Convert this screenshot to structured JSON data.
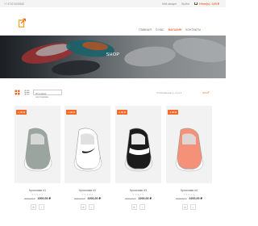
{
  "topbar": {
    "left_text": "+7 4742 4446160",
    "links": [
      "Мой аккаунт",
      "Выйти",
      "0 item(s) - 0,00 ₽"
    ]
  },
  "header": {
    "nav": [
      "Главная",
      "О нас",
      "Магазин",
      "Контакты"
    ],
    "active_nav": "Магазин"
  },
  "hero": {
    "title": "SHOP"
  },
  "toolbar": {
    "sort_label": "Исходная сортировка",
    "result_count": "Отображение 1–4 из 4",
    "show_label": "Show"
  },
  "products": [
    {
      "badge": "-1,00 ₽",
      "name": "Кроссовки #1",
      "rating": "★★★★★",
      "old_price": "3000,00 ₽",
      "price": "1500,00 ₽",
      "shoe_color": "#9aa5a0"
    },
    {
      "badge": "-1,00 ₽",
      "name": "Кроссовки #2",
      "rating": "★★★★★",
      "old_price": "3000,00 ₽",
      "price": "2200,00 ₽",
      "shoe_color": "#ffffff"
    },
    {
      "badge": "-1,00 ₽",
      "name": "Кроссовки #3",
      "rating": "★★★★★",
      "old_price": "3000,00 ₽",
      "price": "2200,00 ₽",
      "shoe_color": "#1b1b1b"
    },
    {
      "badge": "-1,00 ₽",
      "name": "Кроссовки #4",
      "rating": "★★★★★",
      "old_price": "3000,00 ₽",
      "price": "2200,00 ₽",
      "shoe_color": "#f59178"
    }
  ],
  "colors": {
    "accent": "#f06a2a",
    "hero_dark": "#1e2226"
  }
}
